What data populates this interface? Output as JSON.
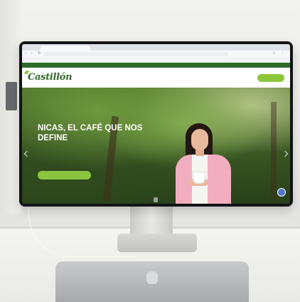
{
  "browser": {
    "tab_title": "",
    "url": "",
    "nav_icons": "‹ › ↻",
    "window_icons": "☆ ⋮",
    "bookmarks": [
      "",
      "",
      "",
      "",
      "",
      "",
      "",
      ""
    ]
  },
  "site": {
    "top_left": "",
    "top_right": "",
    "logo": "Castillón",
    "menu": [
      "",
      "",
      "",
      ""
    ],
    "nav_cta": "",
    "hero": {
      "title": "NICAS, EL CAFÉ QUE NOS DEFINE",
      "subtitle": "",
      "cta": ""
    }
  },
  "colors": {
    "brand_green": "#2f6a2a",
    "accent_green": "#8cc63f",
    "blouse_pink": "#f2aec1"
  }
}
